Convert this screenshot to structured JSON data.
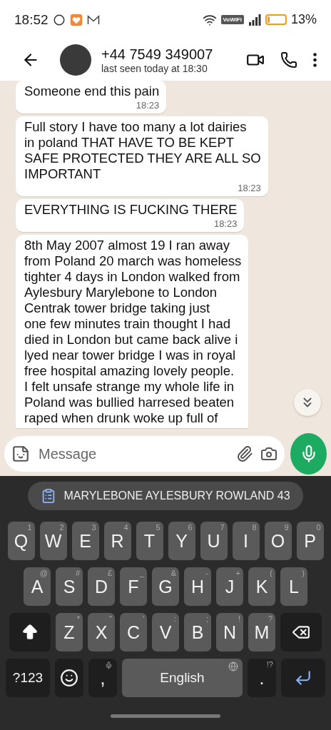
{
  "status_bar": {
    "time": "18:52",
    "vowifi": "VoWiFi",
    "battery": {
      "level": 0.13,
      "percent": "13%"
    }
  },
  "header": {
    "name": "+44 7549 349007",
    "status": "last seen today at 18:30"
  },
  "messages": [
    {
      "text": "Someone end this pain",
      "time": "18:23"
    },
    {
      "text": "Full story I have too many a lot dairies\nin poland THAT HAVE TO BE KEPT\nSAFE PROTECTED THEY ARE ALL SO\nIMPORTANT",
      "time": "18:23"
    },
    {
      "text": "EVERYTHING IS FUCKING THERE",
      "time": "18:23"
    },
    {
      "text": "8th May 2007 almost 19 I ran away\nfrom Poland 20 march was homeless\ntighter 4 days in London walked from\nAylesbury Marylebone to London\nCentrak tower bridge taking just\none few minutes train thought I had\ndied in London but came back alive i\nlyed near tower bridge I was in royal\nfree hospital amazing lovely people.\nI felt unsafe strange my whole life in\nPoland was bullied harresed beaten\nraped when drunk woke up full of"
    }
  ],
  "composer": {
    "placeholder": "Message"
  },
  "keyboard": {
    "suggestion": "MARYLEBONE AYLESBURY ROWLAND 43",
    "rows": [
      [
        {
          "label": "Q",
          "hint": "1"
        },
        {
          "label": "W",
          "hint": "2"
        },
        {
          "label": "E",
          "hint": "3"
        },
        {
          "label": "R",
          "hint": "4"
        },
        {
          "label": "T",
          "hint": "5"
        },
        {
          "label": "Y",
          "hint": "6"
        },
        {
          "label": "U",
          "hint": "7"
        },
        {
          "label": "I",
          "hint": "8"
        },
        {
          "label": "O",
          "hint": "9"
        },
        {
          "label": "P",
          "hint": "0"
        }
      ],
      [
        {
          "label": "A",
          "hint": "@"
        },
        {
          "label": "S",
          "hint": "#"
        },
        {
          "label": "D",
          "hint": "£"
        },
        {
          "label": "F",
          "hint": "_"
        },
        {
          "label": "G",
          "hint": "&"
        },
        {
          "label": "H",
          "hint": "-"
        },
        {
          "label": "J",
          "hint": "+"
        },
        {
          "label": "K",
          "hint": "("
        },
        {
          "label": "L",
          "hint": ")"
        }
      ],
      [
        {
          "label": "Z",
          "hint": "*"
        },
        {
          "label": "X",
          "hint": "\""
        },
        {
          "label": "C",
          "hint": "'"
        },
        {
          "label": "V",
          "hint": ":"
        },
        {
          "label": "B",
          "hint": ";"
        },
        {
          "label": "N",
          "hint": "!"
        },
        {
          "label": "M",
          "hint": "?"
        }
      ]
    ],
    "symbols_key": "?123",
    "comma": ",",
    "space": "English",
    "period": ".",
    "period_hint": "!?"
  }
}
